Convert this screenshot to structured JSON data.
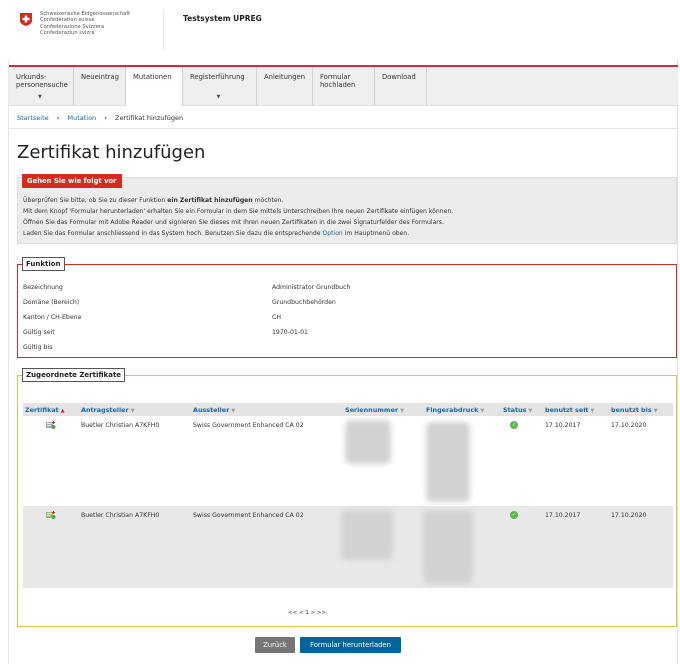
{
  "header": {
    "confederation_lines": [
      "Schweizerische Eidgenossenschaft",
      "Confédération suisse",
      "Confederazione Svizzera",
      "Confederaziun svizra"
    ],
    "system_title": "Testsystem UPREG"
  },
  "nav": {
    "items": [
      {
        "label": "Urkunds-\npersonensuche",
        "has_dropdown": true
      },
      {
        "label": "Neueintrag",
        "has_dropdown": false
      },
      {
        "label": "Mutationen",
        "has_dropdown": false,
        "active": true
      },
      {
        "label": "Registerführung",
        "has_dropdown": true
      },
      {
        "label": "Anleitungen",
        "has_dropdown": false
      },
      {
        "label": "Formular\nhochladen",
        "has_dropdown": false
      },
      {
        "label": "Download",
        "has_dropdown": false
      }
    ]
  },
  "breadcrumb": {
    "home": "Startseite",
    "parent": "Mutation",
    "current": "Zertifikat hinzufügen",
    "separator": "›"
  },
  "page_title": "Zertifikat hinzufügen",
  "info": {
    "tag": "Gehen Sie wie folgt vor",
    "line1_a": "Überprüfen Sie bitte, ob Sie zu dieser Funktion ",
    "line1_b": "ein Zertifikat hinzufügen",
    "line1_c": " möchten.",
    "line2": "Mit dem Knopf 'Formular herunterladen' erhalten Sie ein Formular in dem Sie mittels Unterschreiben Ihre neuen Zertifikate einfügen können.",
    "line3": "Öffnen Sie das Formular mit Adobe Reader und signieren Sie dieses mit Ihren neuen Zertifikaten in die zwei Signaturfelder des Formulars.",
    "line4_a": "Laden Sie das Formular anschliessend in das System hoch. Benutzen Sie dazu die entsprechende ",
    "line4_link": "Option",
    "line4_b": " im Hauptmenü oben."
  },
  "funktion": {
    "legend": "Funktion",
    "fields": [
      {
        "label": "Bezeichnung",
        "value": "Administrator Grundbuch"
      },
      {
        "label": "Domäne (Bereich)",
        "value": "Grundbuchbehörden"
      },
      {
        "label": "Kanton / CH-Ebene",
        "value": "CH"
      },
      {
        "label": "Gültig seit",
        "value": "1970-01-01"
      },
      {
        "label": "Gültig bis",
        "value": ""
      }
    ]
  },
  "zertifikate": {
    "legend": "Zugeordnete Zertifikate",
    "columns": [
      "Zertifikat",
      "Antragsteller",
      "Aussteller",
      "Seriennummer",
      "Fingerabdruck",
      "Status",
      "benutzt seit",
      "benutzt bis"
    ],
    "sort_up_arrow": "▲",
    "sort_arrow": "▼",
    "rows": [
      {
        "antragsteller": "Buetler Christian A7KFH0",
        "aussteller": "Swiss Government Enhanced CA 02",
        "benutzt_seit": "17.10.2017",
        "benutzt_bis": "17.10.2020",
        "status": "ok"
      },
      {
        "antragsteller": "Buetler Christian A7KFH0",
        "aussteller": "Swiss Government Enhanced CA 02",
        "benutzt_seit": "17.10.2017",
        "benutzt_bis": "17.10.2020",
        "status": "ok"
      }
    ],
    "pager": "<< < 1 > >>"
  },
  "buttons": {
    "back": "Zurück",
    "download": "Formular herunterladen"
  },
  "colors": {
    "accent_red": "#d52b1e",
    "link_blue": "#1769a8",
    "button_blue": "#006699",
    "frame_yellow": "#e2c34a",
    "status_green": "#5cb84c"
  }
}
